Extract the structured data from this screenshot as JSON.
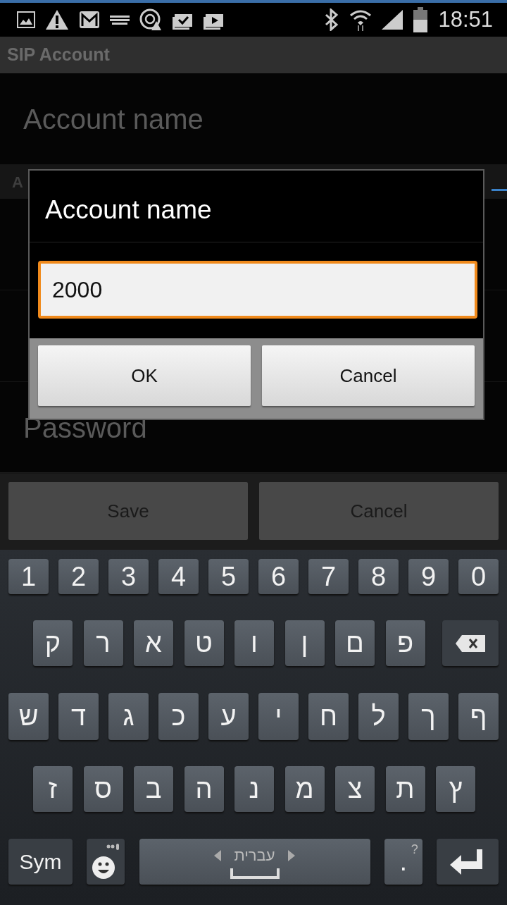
{
  "status_bar": {
    "time": "18:51"
  },
  "app_bar": {
    "title": "SIP Account"
  },
  "settings": [
    {
      "kind": "item",
      "label": "Account name"
    },
    {
      "kind": "header",
      "label": "A"
    },
    {
      "kind": "covered"
    },
    {
      "kind": "covered"
    },
    {
      "kind": "item",
      "label": "Password"
    }
  ],
  "footer_buttons": [
    "Save",
    "Cancel"
  ],
  "dialog": {
    "title": "Account name",
    "field": {
      "value": "2000",
      "focused": true
    },
    "buttons": [
      "OK",
      "Cancel"
    ]
  },
  "keyboard": {
    "rows": [
      [
        {
          "kind": "char",
          "label": "1"
        },
        {
          "kind": "char",
          "label": "2"
        },
        {
          "kind": "char",
          "label": "3"
        },
        {
          "kind": "char",
          "label": "4"
        },
        {
          "kind": "char",
          "label": "5"
        },
        {
          "kind": "char",
          "label": "6"
        },
        {
          "kind": "char",
          "label": "7"
        },
        {
          "kind": "char",
          "label": "8"
        },
        {
          "kind": "char",
          "label": "9"
        },
        {
          "kind": "char",
          "label": "0"
        }
      ],
      [
        {
          "kind": "char",
          "label": "ק"
        },
        {
          "kind": "char",
          "label": "ר"
        },
        {
          "kind": "char",
          "label": "א"
        },
        {
          "kind": "char",
          "label": "ט"
        },
        {
          "kind": "char",
          "label": "ו"
        },
        {
          "kind": "char",
          "label": "ן"
        },
        {
          "kind": "char",
          "label": "ם"
        },
        {
          "kind": "char",
          "label": "פ"
        },
        {
          "kind": "backspace"
        }
      ],
      [
        {
          "kind": "char",
          "label": "ש"
        },
        {
          "kind": "char",
          "label": "ד"
        },
        {
          "kind": "char",
          "label": "ג"
        },
        {
          "kind": "char",
          "label": "כ"
        },
        {
          "kind": "char",
          "label": "ע"
        },
        {
          "kind": "char",
          "label": "י"
        },
        {
          "kind": "char",
          "label": "ח"
        },
        {
          "kind": "char",
          "label": "ל"
        },
        {
          "kind": "char",
          "label": "ך"
        },
        {
          "kind": "char",
          "label": "ף"
        }
      ],
      [
        {
          "kind": "char",
          "label": "ז"
        },
        {
          "kind": "char",
          "label": "ס"
        },
        {
          "kind": "char",
          "label": "ב"
        },
        {
          "kind": "char",
          "label": "ה"
        },
        {
          "kind": "char",
          "label": "נ"
        },
        {
          "kind": "char",
          "label": "מ"
        },
        {
          "kind": "char",
          "label": "צ"
        },
        {
          "kind": "char",
          "label": "ת"
        },
        {
          "kind": "char",
          "label": "ץ"
        }
      ],
      [
        {
          "kind": "sym",
          "label": "Sym"
        },
        {
          "kind": "emoji"
        },
        {
          "kind": "space",
          "label": "עברית"
        },
        {
          "kind": "period",
          "label": ".",
          "hint": "?"
        },
        {
          "kind": "enter"
        }
      ]
    ]
  }
}
